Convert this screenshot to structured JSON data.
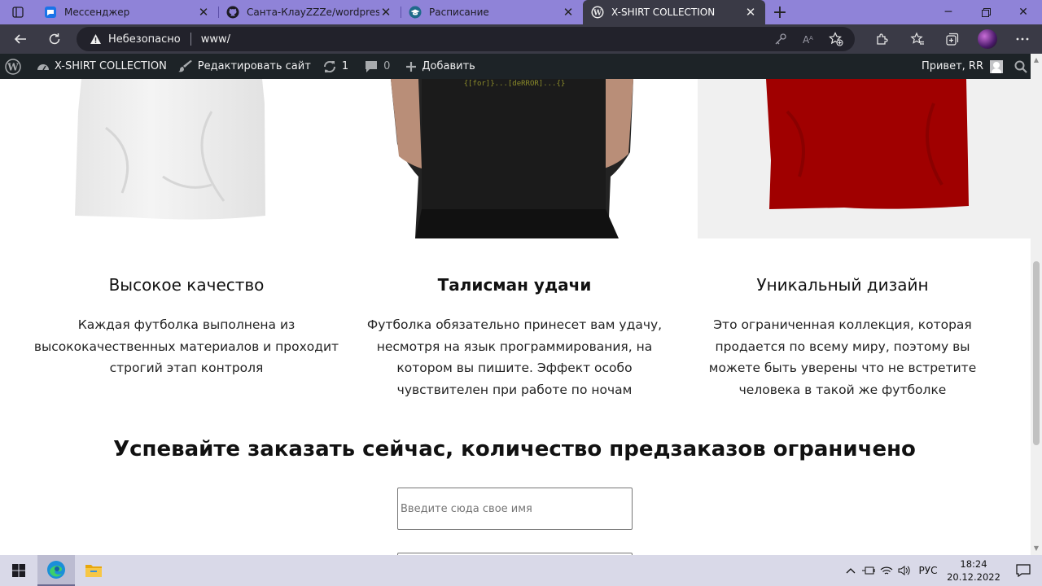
{
  "browser": {
    "tabs": [
      {
        "title": "Мессенджер",
        "icon": "messenger-icon"
      },
      {
        "title": "Санта-КлауZZZe/wordpress_site",
        "icon": "github-icon"
      },
      {
        "title": "Расписание",
        "icon": "graduation-cap-icon"
      },
      {
        "title": "X-SHIRT COLLECTION",
        "icon": "wordpress-icon",
        "active": true
      }
    ],
    "insecure_label": "Небезопасно",
    "url": "www/"
  },
  "wp_admin_bar": {
    "site_name": "X-SHIRT COLLECTION",
    "customize": "Редактировать сайт",
    "updates_count": "1",
    "comments_count": "0",
    "new_label": "Добавить",
    "greeting": "Привет, RR"
  },
  "features": [
    {
      "title": "Высокое качество",
      "text": "Каждая футболка выполнена из высококачественных материалов и проходит строгий этап контроля"
    },
    {
      "title": "Талисман удачи",
      "text": "Футболка обязательно принесет вам удачу, несмотря на язык программирования, на котором вы пишите. Эффект особо чувствителен при работе по ночам"
    },
    {
      "title": "Уникальный дизайн",
      "text": "Это ограниченная коллекция, которая продается по всему миру, поэтому вы можете быть уверены что не встретите человека в такой же футболке"
    }
  ],
  "order": {
    "title": "Успевайте заказать сейчас, количество предзаказов ограничено",
    "name_placeholder": "Введите сюда свое имя"
  },
  "taskbar": {
    "language": "РУС",
    "time": "18:24",
    "date": "20.12.2022"
  },
  "colors": {
    "tabstrip": "#8f83d8",
    "toolbar": "#3a3a46",
    "wp_admin_bar": "#1d2327",
    "shirt_red": "#a00000"
  }
}
